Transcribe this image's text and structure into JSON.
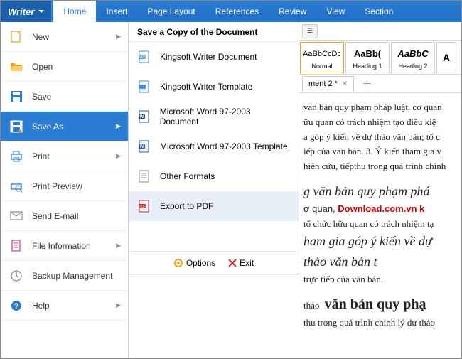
{
  "app": {
    "name": "Writer"
  },
  "menubar": [
    "Home",
    "Insert",
    "Page Layout",
    "References",
    "Review",
    "View",
    "Section"
  ],
  "filemenu": [
    {
      "label": "New",
      "icon": "new",
      "sub": true
    },
    {
      "label": "Open",
      "icon": "open",
      "sub": false
    },
    {
      "label": "Save",
      "icon": "save",
      "sub": false
    },
    {
      "label": "Save As",
      "icon": "saveas",
      "sub": true,
      "selected": true
    },
    {
      "label": "Print",
      "icon": "print",
      "sub": true
    },
    {
      "label": "Print Preview",
      "icon": "preview",
      "sub": false
    },
    {
      "label": "Send E-mail",
      "icon": "mail",
      "sub": false
    },
    {
      "label": "File Information",
      "icon": "info",
      "sub": true
    },
    {
      "label": "Backup Management",
      "icon": "backup",
      "sub": false
    },
    {
      "label": "Help",
      "icon": "help",
      "sub": true
    }
  ],
  "saveAsPanel": {
    "title": "Save a Copy of the Document",
    "items": [
      {
        "label": "Kingsoft Writer Document",
        "icon": "wps"
      },
      {
        "label": "Kingsoft Writer Template",
        "icon": "wpt"
      },
      {
        "label": "Microsoft Word 97-2003 Document",
        "icon": "doc"
      },
      {
        "label": "Microsoft Word 97-2003 Template",
        "icon": "dot"
      },
      {
        "label": "Other Formats",
        "icon": "other"
      },
      {
        "label": "Export to PDF",
        "icon": "pdf",
        "hover": true
      }
    ],
    "footer": {
      "options": "Options",
      "exit": "Exit"
    }
  },
  "ribbon": {
    "styles": [
      {
        "preview": "AaBbCcDc",
        "name": "Normal",
        "selected": true,
        "bold": false,
        "italic": false
      },
      {
        "preview": "AaBb(",
        "name": "Heading 1",
        "bold": true,
        "italic": false
      },
      {
        "preview": "AaBbC",
        "name": "Heading 2",
        "bold": true,
        "italic": true
      },
      {
        "preview": "A",
        "name": "",
        "bold": true,
        "italic": false
      }
    ]
  },
  "tabs": {
    "doc": "ment 2 *"
  },
  "document": {
    "p1a": "văn bản quy phạm pháp luật, cơ quan",
    "p1b": "ữu quan có trách nhiệm tạo điều kiệ",
    "p1c": "a góp ý kiến về dự thảo văn bản; tổ c",
    "p1d": "iếp của văn bản. 3. Ý kiến tham gia v",
    "p1e": "hiên cứu, tiếpthu trong quá trình chỉnh",
    "p2a": "g văn bản quy phạm phá",
    "p2b_pre": "ơ quan,",
    "p2b_wm": "Download.com.vn k",
    "p2c": "tổ chức hữu quan có trách nhiệm tạ",
    "p2d": "ham gia góp ý kiến về dự thảo văn bản t",
    "p2e": "trực tiếp của văn bản.",
    "p3a": "thảo",
    "p3b": "văn bản quy phạ",
    "p3c": "thu trong quá trình chỉnh lý dự thảo"
  }
}
